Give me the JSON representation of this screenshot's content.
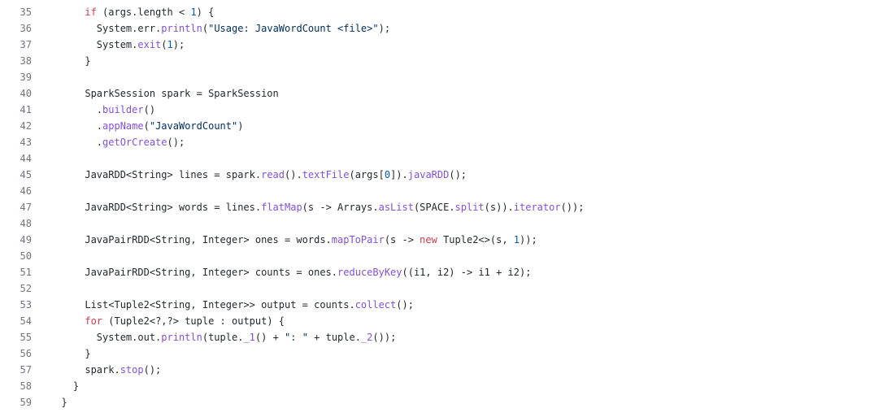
{
  "colors": {
    "keyword": "#d73a49",
    "function": "#8250df",
    "string": "#032f62",
    "number": "#005cc5",
    "plain": "#24292e",
    "line_number": "#6e7781",
    "background": "#ffffff"
  },
  "lines": [
    {
      "num": "35",
      "tokens": [
        {
          "t": "      "
        },
        {
          "t": "if",
          "c": "kw"
        },
        {
          "t": " (args.length < "
        },
        {
          "t": "1",
          "c": "num"
        },
        {
          "t": ") {"
        }
      ]
    },
    {
      "num": "36",
      "tokens": [
        {
          "t": "        System.err."
        },
        {
          "t": "println",
          "c": "fn"
        },
        {
          "t": "("
        },
        {
          "t": "\"Usage: JavaWordCount <file>\"",
          "c": "str"
        },
        {
          "t": ");"
        }
      ]
    },
    {
      "num": "37",
      "tokens": [
        {
          "t": "        System."
        },
        {
          "t": "exit",
          "c": "fn"
        },
        {
          "t": "("
        },
        {
          "t": "1",
          "c": "num"
        },
        {
          "t": ");"
        }
      ]
    },
    {
      "num": "38",
      "tokens": [
        {
          "t": "      }"
        }
      ]
    },
    {
      "num": "39",
      "tokens": []
    },
    {
      "num": "40",
      "tokens": [
        {
          "t": "      SparkSession spark = SparkSession"
        }
      ]
    },
    {
      "num": "41",
      "tokens": [
        {
          "t": "        ."
        },
        {
          "t": "builder",
          "c": "fn"
        },
        {
          "t": "()"
        }
      ]
    },
    {
      "num": "42",
      "tokens": [
        {
          "t": "        ."
        },
        {
          "t": "appName",
          "c": "fn"
        },
        {
          "t": "("
        },
        {
          "t": "\"JavaWordCount\"",
          "c": "str"
        },
        {
          "t": ")"
        }
      ]
    },
    {
      "num": "43",
      "tokens": [
        {
          "t": "        ."
        },
        {
          "t": "getOrCreate",
          "c": "fn"
        },
        {
          "t": "();"
        }
      ]
    },
    {
      "num": "44",
      "tokens": []
    },
    {
      "num": "45",
      "tokens": [
        {
          "t": "      JavaRDD<String> lines = spark."
        },
        {
          "t": "read",
          "c": "fn"
        },
        {
          "t": "()."
        },
        {
          "t": "textFile",
          "c": "fn"
        },
        {
          "t": "(args["
        },
        {
          "t": "0",
          "c": "num"
        },
        {
          "t": "])."
        },
        {
          "t": "javaRDD",
          "c": "fn"
        },
        {
          "t": "();"
        }
      ]
    },
    {
      "num": "46",
      "tokens": []
    },
    {
      "num": "47",
      "tokens": [
        {
          "t": "      JavaRDD<String> words = lines."
        },
        {
          "t": "flatMap",
          "c": "fn"
        },
        {
          "t": "(s -> Arrays."
        },
        {
          "t": "asList",
          "c": "fn"
        },
        {
          "t": "(SPACE."
        },
        {
          "t": "split",
          "c": "fn"
        },
        {
          "t": "(s))."
        },
        {
          "t": "iterator",
          "c": "fn"
        },
        {
          "t": "());"
        }
      ]
    },
    {
      "num": "48",
      "tokens": []
    },
    {
      "num": "49",
      "tokens": [
        {
          "t": "      JavaPairRDD<String, Integer> ones = words."
        },
        {
          "t": "mapToPair",
          "c": "fn"
        },
        {
          "t": "(s -> "
        },
        {
          "t": "new",
          "c": "kw"
        },
        {
          "t": " Tuple2<>(s, "
        },
        {
          "t": "1",
          "c": "num"
        },
        {
          "t": "));"
        }
      ]
    },
    {
      "num": "50",
      "tokens": []
    },
    {
      "num": "51",
      "tokens": [
        {
          "t": "      JavaPairRDD<String, Integer> counts = ones."
        },
        {
          "t": "reduceByKey",
          "c": "fn"
        },
        {
          "t": "((i1, i2) -> i1 + i2);"
        }
      ]
    },
    {
      "num": "52",
      "tokens": []
    },
    {
      "num": "53",
      "tokens": [
        {
          "t": "      List<Tuple2<String, Integer>> output = counts."
        },
        {
          "t": "collect",
          "c": "fn"
        },
        {
          "t": "();"
        }
      ]
    },
    {
      "num": "54",
      "tokens": [
        {
          "t": "      "
        },
        {
          "t": "for",
          "c": "kw"
        },
        {
          "t": " (Tuple2<?,?> tuple : output) {"
        }
      ]
    },
    {
      "num": "55",
      "tokens": [
        {
          "t": "        System.out."
        },
        {
          "t": "println",
          "c": "fn"
        },
        {
          "t": "(tuple."
        },
        {
          "t": "_1",
          "c": "fn"
        },
        {
          "t": "() + "
        },
        {
          "t": "\": \"",
          "c": "str"
        },
        {
          "t": " + tuple."
        },
        {
          "t": "_2",
          "c": "fn"
        },
        {
          "t": "());"
        }
      ]
    },
    {
      "num": "56",
      "tokens": [
        {
          "t": "      }"
        }
      ]
    },
    {
      "num": "57",
      "tokens": [
        {
          "t": "      spark."
        },
        {
          "t": "stop",
          "c": "fn"
        },
        {
          "t": "();"
        }
      ]
    },
    {
      "num": "58",
      "tokens": [
        {
          "t": "    }"
        }
      ]
    },
    {
      "num": "59",
      "tokens": [
        {
          "t": "  }"
        }
      ]
    }
  ]
}
